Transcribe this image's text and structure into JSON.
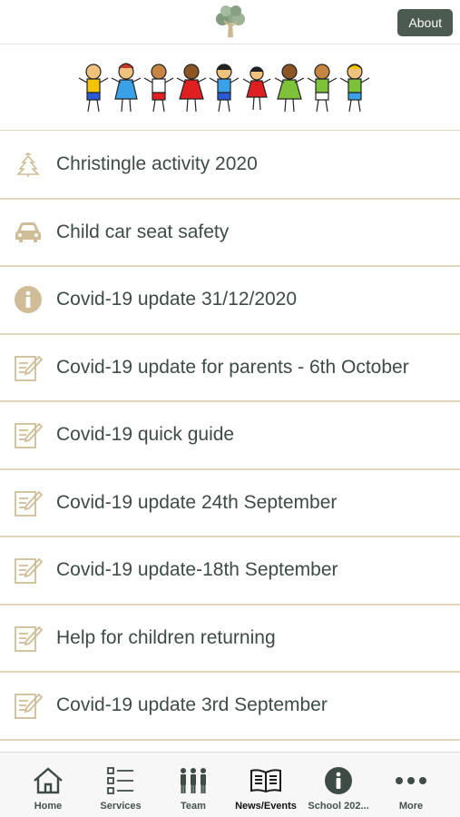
{
  "header": {
    "about_label": "About"
  },
  "colors": {
    "accent": "#4b5b4f",
    "icon_tan": "#d8c7a5",
    "divider": "#e2d5bc",
    "text": "#3e4c45"
  },
  "list": {
    "items": [
      {
        "label": "Christingle activity 2020",
        "icon": "christmas-tree-icon"
      },
      {
        "label": "Child car seat safety",
        "icon": "car-icon"
      },
      {
        "label": "Covid-19 update 31/12/2020",
        "icon": "info-icon"
      },
      {
        "label": "Covid-19 update for parents - 6th October",
        "icon": "note-edit-icon"
      },
      {
        "label": "Covid-19 quick guide",
        "icon": "note-edit-icon"
      },
      {
        "label": "Covid-19 update 24th September",
        "icon": "note-edit-icon"
      },
      {
        "label": "Covid-19 update-18th September",
        "icon": "note-edit-icon"
      },
      {
        "label": "Help for children returning",
        "icon": "note-edit-icon"
      },
      {
        "label": "Covid-19 update 3rd September",
        "icon": "note-edit-icon"
      }
    ]
  },
  "tabbar": {
    "tabs": [
      {
        "label": "Home",
        "icon": "home-icon",
        "active": false
      },
      {
        "label": "Services",
        "icon": "list-icon",
        "active": false
      },
      {
        "label": "Team",
        "icon": "team-icon",
        "active": false
      },
      {
        "label": "News/Events",
        "icon": "book-icon",
        "active": true
      },
      {
        "label": "School 202...",
        "icon": "info-icon",
        "active": false
      },
      {
        "label": "More",
        "icon": "more-icon",
        "active": false
      }
    ]
  }
}
